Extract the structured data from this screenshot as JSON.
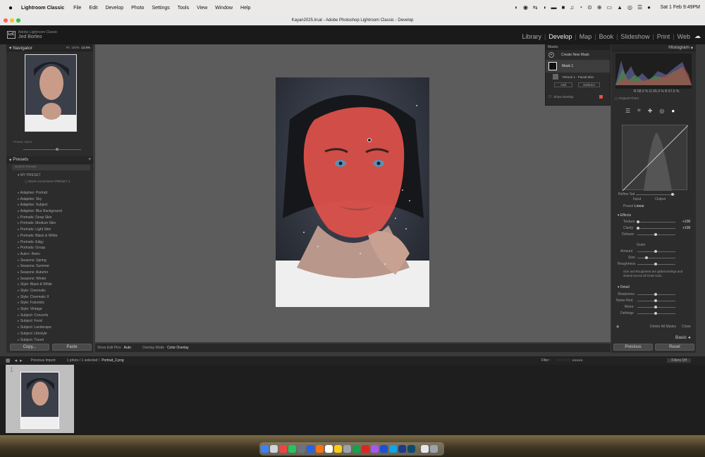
{
  "menubar": {
    "app": "Lightroom Classic",
    "items": [
      "File",
      "Edit",
      "Develop",
      "Photo",
      "Settings",
      "Tools",
      "View",
      "Window",
      "Help"
    ],
    "clock": "Sat 1 Feb  9:49PM"
  },
  "window": {
    "title": "Kayan2025.lrcat - Adobe Photoshop Lightroom Classic - Develop"
  },
  "identity": {
    "product": "Adobe Lightroom Classic",
    "user": "Jed Borleo"
  },
  "modules": [
    "Library",
    "Develop",
    "Map",
    "Book",
    "Slideshow",
    "Print",
    "Web"
  ],
  "navigator": {
    "title": "Navigator",
    "zoom1": "Fit",
    "zoom2": "100%",
    "zoom3": "12.5%"
  },
  "presets": {
    "title": "Presets",
    "search": "Search Presets",
    "group": "MY PRESET",
    "custom": "MAIN JAAZANAH PRESET 2",
    "items": [
      "Adaptive: Portrait",
      "Adaptive: Sky",
      "Adaptive: Subject",
      "Adaptive: Blur Background",
      "Portraits: Deep Skin",
      "Portraits: Medium Skin",
      "Portraits: Light Skin",
      "Portraits: Black & White",
      "Portraits: Edgy",
      "Portraits: Group",
      "Auto+: Retro",
      "Seasons: Spring",
      "Seasons: Summer",
      "Seasons: Autumn",
      "Seasons: Winter",
      "Style: Black & White",
      "Style: Cinematic",
      "Style: Cinematic II",
      "Style: Futuristic",
      "Style: Vintage",
      "Subject: Concerts",
      "Subject: Food",
      "Subject: Landscape",
      "Subject: Lifestyle",
      "Subject: Travel"
    ]
  },
  "leftbuttons": {
    "copy": "Copy...",
    "paste": "Paste"
  },
  "masks": {
    "title": "Masks",
    "create": "Create New Mask",
    "mask1": "Mask 1",
    "person": "Person 1 - Facial Skin",
    "add": "Add",
    "subtract": "Subtract",
    "overlay": "Show Overlay"
  },
  "centerbar": {
    "edit_pins": "Show Edit Pins",
    "edit_pins_value": "Auto",
    "overlay_mode": "Overlay Mode",
    "overlay_value": "Color Overlay"
  },
  "histogram": {
    "title": "Histogram",
    "r": "68.0",
    "g": "65.9",
    "b": "67.6",
    "original": "Original Photo"
  },
  "curve": {
    "refine": "Refine Sat",
    "input": "Input",
    "output": "Output",
    "preset": "Linear"
  },
  "effects": {
    "title": "Effects",
    "texture": "Texture",
    "texture_val": "+100",
    "clarity": "Clarity",
    "clarity_val": "+100",
    "dehaze": "Dehaze",
    "grain": "Grain",
    "amount": "Amount",
    "size": "Size",
    "roughness": "Roughness",
    "grain_note": "Size and Roughness are global settings and shared across all Grain tools."
  },
  "detail": {
    "title": "Detail",
    "sharpness": "Sharpness",
    "noise": "Noise Red.",
    "moire": "Moire",
    "defringe": "Defringe"
  },
  "maskfoot": {
    "delete": "Delete All Masks",
    "close": "Close"
  },
  "basic": "Basic",
  "rightbuttons": {
    "previous": "Previous",
    "reset": "Reset"
  },
  "filmbar": {
    "source": "Previous Import",
    "status": "1 photo / 1 selected /",
    "file": "Portrait_2.png",
    "filter": "Filter :",
    "filters_off": "Filters Off"
  },
  "film": {
    "index": "1"
  },
  "colors": {
    "mask_overlay": "#e0524a",
    "accent": "#f0f0f0"
  }
}
